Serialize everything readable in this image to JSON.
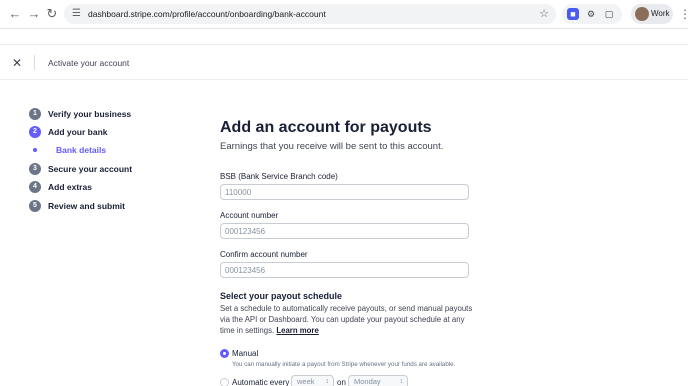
{
  "browser": {
    "url": "dashboard.stripe.com/profile/account/onboarding/bank-account",
    "profile_label": "Work"
  },
  "header": {
    "title": "Activate your account"
  },
  "steps": [
    {
      "number": "1",
      "label": "Verify your business"
    },
    {
      "number": "2",
      "label": "Add your bank"
    },
    {
      "number": "3",
      "label": "Secure your account"
    },
    {
      "number": "4",
      "label": "Add extras"
    },
    {
      "number": "5",
      "label": "Review and submit"
    }
  ],
  "substep": {
    "label": "Bank details"
  },
  "form": {
    "title": "Add an account for payouts",
    "subtitle": "Earnings that you receive will be sent to this account.",
    "bsb_label": "BSB (Bank Service Branch code)",
    "bsb_placeholder": "110000",
    "account_label": "Account number",
    "account_placeholder": "000123456",
    "confirm_label": "Confirm account number",
    "confirm_placeholder": "000123456"
  },
  "schedule": {
    "title": "Select your payout schedule",
    "description": "Set a schedule to automatically receive payouts, or send manual payouts via the API or Dashboard. You can update your payout schedule at any time in settings.",
    "learn_more": "Learn more",
    "manual_label": "Manual",
    "manual_help": "You can manually initiate a payout from Stripe whenever your funds are available.",
    "automatic_label": "Automatic every",
    "interval_value": "week",
    "on_label": "on",
    "day_value": "Monday"
  },
  "colors": {
    "accent": "#635bff",
    "text": "#1a1f36",
    "muted": "#687385"
  }
}
